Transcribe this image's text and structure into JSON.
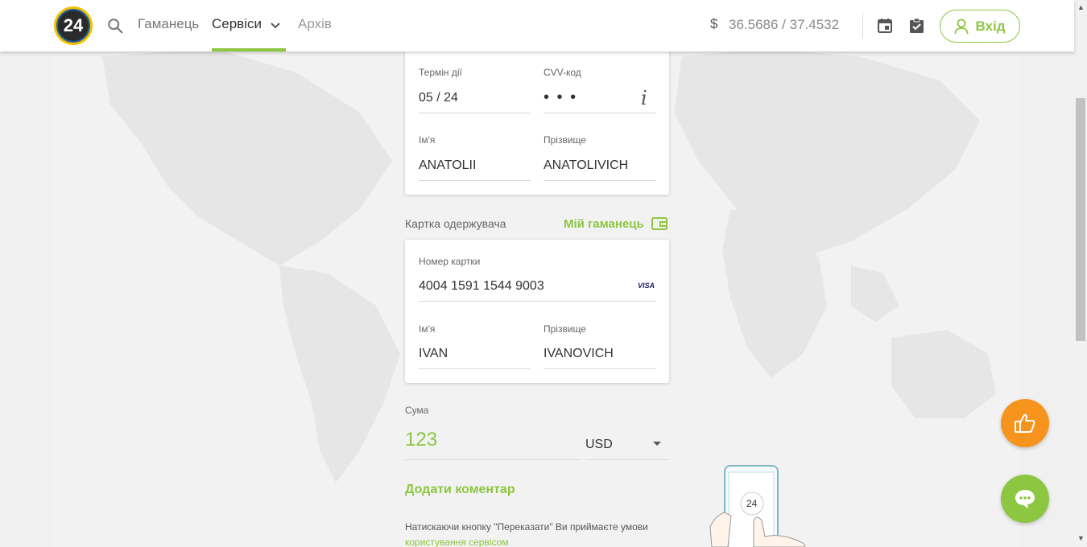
{
  "header": {
    "logo_text": "24",
    "nav": {
      "wallet": "Гаманець",
      "services": "Сервіси",
      "archive": "Архів"
    },
    "rate_symbol": "$",
    "rate": "36.5686 / 37.4532",
    "login_label": "Вхід"
  },
  "sender_card": {
    "expiry_label": "Термін дії",
    "expiry_value": "05 / 24",
    "cvv_label": "CVV-код",
    "cvv_value": "• • •",
    "cvv_info_icon": "i",
    "first_name_label": "Ім'я",
    "first_name_value": "ANATOLII",
    "last_name_label": "Прізвище",
    "last_name_value": "ANATOLIVICH"
  },
  "recipient_section": {
    "label": "Картка одержувача",
    "wallet_link": "Мій гаманець"
  },
  "recipient_card": {
    "card_number_label": "Номер картки",
    "card_number_value": "4004 1591 1544 9003",
    "card_brand": "VISA",
    "first_name_label": "Ім'я",
    "first_name_value": "IVAN",
    "last_name_label": "Прізвище",
    "last_name_value": "IVANOVICH"
  },
  "amount": {
    "label": "Сума",
    "value": "123",
    "currency": "USD"
  },
  "add_comment": "Додати коментар",
  "terms": {
    "text": "Натискаючи кнопку \"Переказати\" Ви приймаєте умови ",
    "link": "користування сервісом"
  },
  "phone_badge": "24",
  "colors": {
    "accent": "#8dc641",
    "orange": "#f7941d"
  },
  "icons": [
    "search-icon",
    "chevron-down-icon",
    "calendar-icon",
    "clipboard-check-icon",
    "user-icon",
    "info-icon",
    "wallet-icon",
    "thumbs-up-icon",
    "chat-icon"
  ]
}
